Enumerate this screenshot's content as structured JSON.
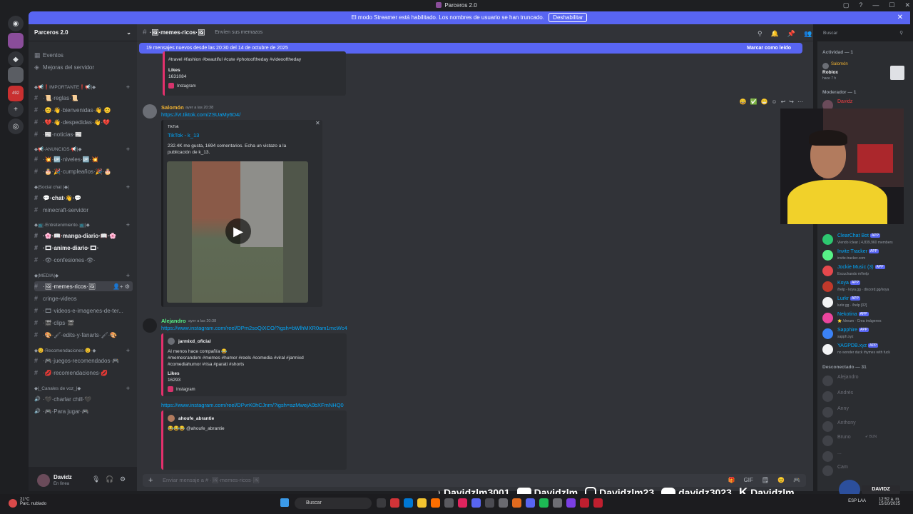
{
  "window": {
    "title": "Parceros 2.0",
    "controls": [
      "▢",
      "?",
      "—",
      "☐",
      "✕"
    ]
  },
  "banner": {
    "text": "El modo Streamer está habilitado. Los nombres de usuario se han truncado.",
    "button": "Deshabilitar",
    "close": "✕"
  },
  "guild": {
    "name": "Parceros 2.0",
    "chevron": "⌄"
  },
  "channels": [
    {
      "type": "item",
      "label": "Eventos",
      "icon": "calendar-icon"
    },
    {
      "type": "item",
      "label": "Mejoras del servidor",
      "icon": "boost-icon"
    },
    {
      "type": "category",
      "label": "◆📢❗IMPORTANTE❗📢|◆"
    },
    {
      "type": "channel",
      "label": "·📜·reglas·📜"
    },
    {
      "type": "channel",
      "label": "·😊·👋·bienvenidas·👋·😊"
    },
    {
      "type": "channel",
      "label": "·💔·👋·despedidas·👋·💔"
    },
    {
      "type": "channel",
      "label": "·📰·noticias·📰"
    },
    {
      "type": "category",
      "label": "◆📢·ANUNCIOS·📢|◆"
    },
    {
      "type": "channel",
      "label": "·💥·🆙·niveles·🆙·💥"
    },
    {
      "type": "channel",
      "label": "·🎂·🎉·cumpleaños·🎉·🎂"
    },
    {
      "type": "category",
      "label": "◆|Social chat |◆|"
    },
    {
      "type": "channel",
      "label": "💬·chat·👋·💬",
      "bold": true
    },
    {
      "type": "channel",
      "label": "minecraft-servidor"
    },
    {
      "type": "category",
      "label": "◆📺·Entretenimiento·📺|◆"
    },
    {
      "type": "channel",
      "label": "·🌸·📖·manga-diario·📖·🌸",
      "bold": true
    },
    {
      "type": "channel",
      "label": "·🎞·anime-diario·🎞·",
      "bold": true
    },
    {
      "type": "channel",
      "label": "·👁·confesiones·👁·"
    },
    {
      "type": "category",
      "label": "◆|MEDIA|◆"
    },
    {
      "type": "channel",
      "label": "·🖼·memes-ricos·🖼",
      "active": true
    },
    {
      "type": "channel",
      "label": "cringe-videos"
    },
    {
      "type": "channel",
      "label": "·🎞·videos-e-imagenes-de-ter..."
    },
    {
      "type": "channel",
      "label": "·🎬·clips·🎬"
    },
    {
      "type": "channel",
      "label": "·🎨·🖌·edits-y-fanarts·🖌·🎨"
    },
    {
      "type": "category",
      "label": "◆😊·Recomendaciones·😊·◆"
    },
    {
      "type": "channel",
      "label": "·🎮·juegos-recomendados·🎮"
    },
    {
      "type": "channel",
      "label": "·💋·recomendaciones·💋"
    },
    {
      "type": "category",
      "label": "◆|_Canales de voz_|◆"
    },
    {
      "type": "voice",
      "label": "·🖤·charlar chill·🖤"
    },
    {
      "type": "voice",
      "label": "·🎮·Para jugar·🎮"
    }
  ],
  "user": {
    "name": "Davidz",
    "status": "En línea",
    "controls": [
      "🎙",
      "🎧",
      "⚙"
    ]
  },
  "chat": {
    "channel_name": "·🖼·memes-ricos·🖼",
    "topic": "Envíen sus memazos",
    "header_icons": [
      "⚲",
      "🔔",
      "📌",
      "👥"
    ],
    "new_messages_text": "19 mensajes nuevos desde las 20:30 del 14 de octubre de 2025",
    "mark_read": "Marcar como leído",
    "top_embed": {
      "hashtags": "#travel #fashion #beautiful #cute #photooftheday #videooftheday",
      "likes_label": "Likes",
      "likes_value": "1631084",
      "source": "Instagram"
    },
    "msg1": {
      "author": "Salomón",
      "time": "ayer a las 20:38",
      "link": "https://vt.tiktok.com/ZSUaMy6D4/",
      "embed_provider": "TikTok",
      "embed_title": "TikTok - k_13",
      "embed_desc": "232.4K me gusta, 1694 comentarios. Echa un vistazo a la publicación de k_13.",
      "play": "▶",
      "close": "✕"
    },
    "msg_actions": [
      "😄",
      "✅",
      "😬",
      "☺",
      "↩",
      "↪",
      "⋯"
    ],
    "msg2": {
      "author": "Alejandro",
      "time": "ayer a las 20:38",
      "link1": "https://www.instagram.com/reel/DPm2soQiXCO/?igsh=bWlhMXR0am1mcWc4",
      "embed1_author": "jarmixd_oficial",
      "embed1_text": "Al menos hace compañía 😂",
      "embed1_tags": "#memesrandom #memes #humor #reels #comedia #viral #jarmixd",
      "embed1_tags2": "#comediahumor #risa #parati #shorts",
      "embed1_likes_label": "Likes",
      "embed1_likes": "16293",
      "embed1_source": "Instagram",
      "link2": "https://www.instagram.com/reel/DPvrK0hCJnm/?igsh=azMwejA0bXFmNHQ0",
      "embed2_author": "ahoufe_abrantie",
      "embed2_text": "😂😂😂 @ahoufe_abrantie"
    },
    "composer_placeholder": "Enviar mensaje a # ·🖼·memes-ricos·🖼",
    "composer_plus": "+",
    "composer_icons": [
      "🎁",
      "GIF",
      "🗒",
      "😊",
      "🎮"
    ]
  },
  "members": {
    "activity_header": "Actividad — 1",
    "activity": {
      "name": "Salomón",
      "game": "Roblox",
      "time": "hace 7 h"
    },
    "mod_header": "Moderador — 1",
    "mod_name": "Davidz",
    "online": [
      {
        "name": "ClearChat Bot",
        "sub": "Viendo /clear | 4,839,960 members",
        "app": "APP",
        "color": "#2dc770"
      },
      {
        "name": "Invite Tracker",
        "sub": "invite-tracker.com",
        "app": "APP",
        "color": "#57f287"
      },
      {
        "name": "Jockie Music (3)",
        "sub": "Escuchando m!help",
        "app": "APP",
        "color": "#e5484d"
      },
      {
        "name": "Koya",
        "sub": "/help - koya.gg · discord.gg/koya",
        "app": "APP",
        "color": "#c0392b"
      },
      {
        "name": "Lurkr",
        "sub": "lurkr.gg · /help [02]",
        "app": "APP",
        "color": "#f2f3f5"
      },
      {
        "name": "Nekotina",
        "sub": "⭐ /dream · Crea imágenes",
        "app": "APP",
        "color": "#eb459e"
      },
      {
        "name": "Sapphire",
        "sub": "sapph.xyz",
        "app": "APP",
        "color": "#3b82f6"
      },
      {
        "name": "YAGPDB.xyz",
        "sub": "no wonder duck rhymes with fuck",
        "app": "APP",
        "color": "#f2f3f5"
      }
    ],
    "offline_header": "Desconectado — 31",
    "offline": [
      "Alejandro",
      "Andrés",
      "Anny",
      "Anthony",
      "Bruno",
      "...",
      "Cam"
    ],
    "offline_sub": "✔ BUN"
  },
  "overlay": {
    "social": [
      {
        "icon": "tiktok-icon",
        "label": "Davidzlm3001"
      },
      {
        "icon": "youtube-icon",
        "label": "Davidzlm"
      },
      {
        "icon": "instagram-icon",
        "label": "Davidzlm23"
      },
      {
        "icon": "discord-icon",
        "label": "davidz3023"
      },
      {
        "icon": "kick-icon",
        "label": "Davidzlm"
      }
    ],
    "badge": "DAVIDZ"
  },
  "taskbar": {
    "temp": "21°C",
    "weather": "Parc. nublado",
    "search": "Buscar",
    "lang": "ESP LAA",
    "time": "12:52 a. m.",
    "date": "15/10/2025"
  },
  "colors": {
    "accent": "#5865f2",
    "salomon": "#f0b232",
    "alejandro": "#57f287",
    "link": "#00a8fc"
  }
}
